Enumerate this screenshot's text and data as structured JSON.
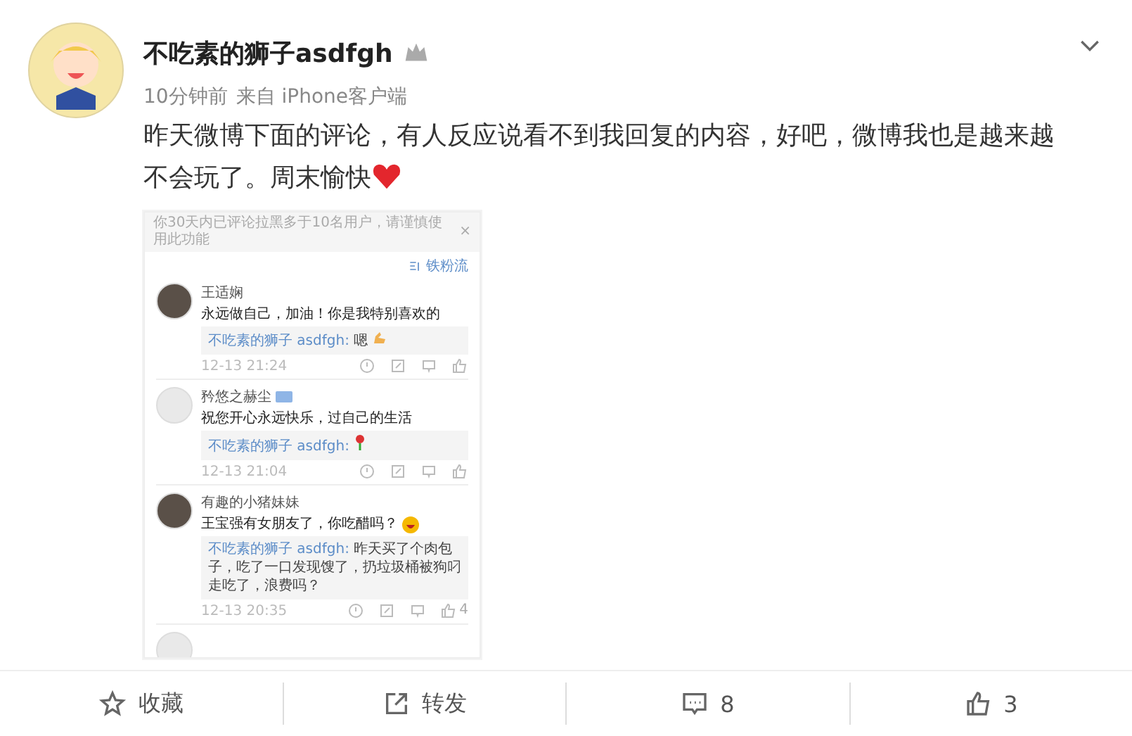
{
  "post": {
    "author": "不吃素的狮子asdfgh",
    "time": "10分钟前",
    "source": "来自 iPhone客户端",
    "text": "昨天微博下面的评论，有人反应说看不到我回复的内容，好吧，微博我也是越来越不会玩了。周末愉快"
  },
  "screenshot": {
    "notice": "你30天内已评论拉黑多于10名用户，请谨慎使用此功能",
    "notice_close": "×",
    "sort": "铁粉流",
    "comments": [
      {
        "name": "王适娴",
        "tagged": false,
        "text": "永远做自己，加油！你是我特别喜欢的",
        "reply_author": "不吃素的狮子 asdfgh:",
        "reply_text": "嗯",
        "time": "12-13 21:24"
      },
      {
        "name": "矜悠之赫尘",
        "tagged": true,
        "text": "祝您开心永远快乐，过自己的生活",
        "reply_author": "不吃素的狮子 asdfgh:",
        "time": "12-13 21:04"
      },
      {
        "name": "有趣的小猪妹妹",
        "tagged": false,
        "text": "王宝强有女朋友了，你吃醋吗？",
        "reply_author": "不吃素的狮子 asdfgh:",
        "reply_text": "昨天买了个肉包子，吃了一口发现馊了，扔垃圾桶被狗叼走吃了，浪费吗？",
        "time": "12-13 20:35",
        "likes": "4"
      }
    ]
  },
  "actions": [
    {
      "kind": "favorite",
      "label": "收藏"
    },
    {
      "kind": "repost",
      "label": "转发"
    },
    {
      "kind": "comment",
      "label": "8"
    },
    {
      "kind": "like",
      "label": "3"
    }
  ]
}
